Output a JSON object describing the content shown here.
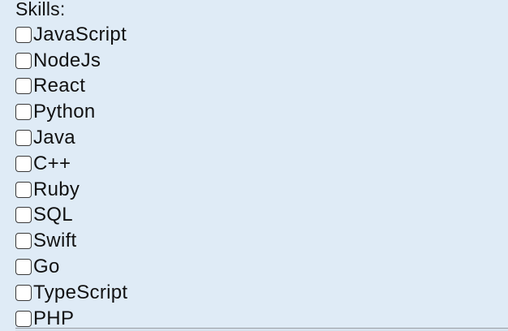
{
  "form": {
    "heading": "Skills:",
    "skills": [
      {
        "label": "JavaScript",
        "checked": false
      },
      {
        "label": "NodeJs",
        "checked": false
      },
      {
        "label": "React",
        "checked": false
      },
      {
        "label": "Python",
        "checked": false
      },
      {
        "label": "Java",
        "checked": false
      },
      {
        "label": "C++",
        "checked": false
      },
      {
        "label": "Ruby",
        "checked": false
      },
      {
        "label": "SQL",
        "checked": false
      },
      {
        "label": "Swift",
        "checked": false
      },
      {
        "label": "Go",
        "checked": false
      },
      {
        "label": "TypeScript",
        "checked": false
      },
      {
        "label": "PHP",
        "checked": false
      }
    ]
  },
  "colors": {
    "background": "#dfebf6",
    "text": "#111111",
    "checkbox_border": "#3a3a3a"
  }
}
